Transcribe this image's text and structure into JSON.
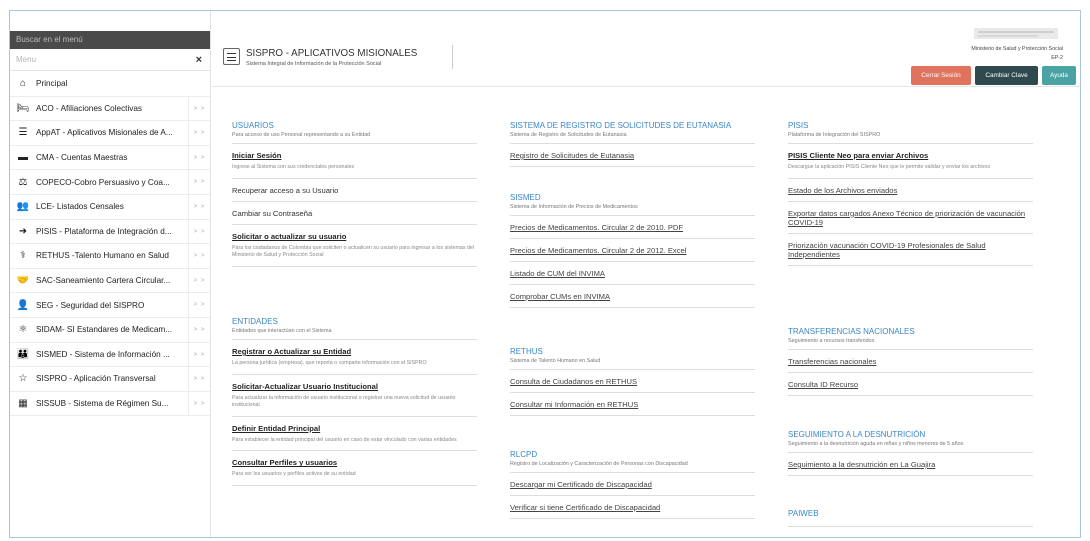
{
  "sidebar": {
    "search_placeholder": "Buscar en el menú",
    "filter_placeholder": "Menu",
    "principal": "Principal",
    "items": [
      {
        "label": "ACO - Afiliaciones Colectivas",
        "icon": "bed-icon",
        "glyph": "🛏"
      },
      {
        "label": "AppAT - Aplicativos Misionales de A...",
        "icon": "list-icon",
        "glyph": "☰"
      },
      {
        "label": "CMA - Cuentas Maestras",
        "icon": "card-icon",
        "glyph": "▬"
      },
      {
        "label": "COPECO-Cobro Persuasivo y Coa...",
        "icon": "gavel-icon",
        "glyph": "⚖"
      },
      {
        "label": "LCE- Listados Censales",
        "icon": "group-icon",
        "glyph": "👥"
      },
      {
        "label": "PISIS - Plataforma de Integración d...",
        "icon": "arrow-icon",
        "glyph": "➜"
      },
      {
        "label": "RETHUS -Talento Humano en Salud",
        "icon": "stethoscope-icon",
        "glyph": "⚕"
      },
      {
        "label": "SAC-Saneamiento Cartera Circular...",
        "icon": "handshake-icon",
        "glyph": "🤝"
      },
      {
        "label": "SEG - Seguridad del SISPRO",
        "icon": "user-icon",
        "glyph": "👤"
      },
      {
        "label": "SIDAM- SI Estandares de Medicam...",
        "icon": "molecule-icon",
        "glyph": "⚛"
      },
      {
        "label": "SISMED - Sistema de Información ...",
        "icon": "users-icon",
        "glyph": "👪"
      },
      {
        "label": "SISPRO - Aplicación Transversal",
        "icon": "star-icon",
        "glyph": "☆"
      },
      {
        "label": "SISSUB - Sistema de Régimen Su...",
        "icon": "building-icon",
        "glyph": "▦"
      }
    ]
  },
  "header": {
    "title": "SISPRO - APLICATIVOS MISIONALES",
    "subtitle": "Sistema Integral de Información de la Protección Social",
    "ministry": "Ministerio de Salud y Protección Social",
    "code": "EP-2",
    "buttons": {
      "logout": "Cerrar Sesión",
      "change_password": "Cambiar Clave",
      "help": "Ayuda"
    }
  },
  "columns": {
    "usuarios": {
      "title": "USUARIOS",
      "desc": "Para acceso de uso Personal representando a su Entidad",
      "items": [
        {
          "title": "Iniciar Sesión",
          "desc": "Ingrese al Sistema con sus credenciales personales"
        },
        {
          "title": "Recuperar acceso a su Usuario"
        },
        {
          "title": "Cambiar su Contraseña"
        },
        {
          "title": "Solicitar o actualizar su usuario",
          "desc": "Para los ciudadanos de Colombia que soliciten o actualicen su usuario para ingresar a los sistemas del Ministerio de Salud y Protección Social"
        }
      ]
    },
    "entidades": {
      "title": "ENTIDADES",
      "desc": "Entidades que interactúan con el Sistema",
      "items": [
        {
          "title": "Registrar o Actualizar su Entidad",
          "desc": "La persona jurídica (empresa), que reporta o comparte información con el SISPRO"
        },
        {
          "title": "Solicitar-Actualizar Usuario Institucional",
          "desc": "Para actualizar la información de usuario institucional o registrar una nueva solicitud de usuario institucional"
        },
        {
          "title": "Definir Entidad Principal",
          "desc": "Para establecer la entidad principal del usuario en caso de estar vinculado con varias entidades"
        },
        {
          "title": "Consultar Perfiles y usuarios",
          "desc": "Para ver los usuarios y perfiles activos de su entidad"
        }
      ]
    },
    "eutanasia": {
      "title": "SISTEMA DE REGISTRO DE SOLICITUDES DE EUTANASIA",
      "desc": "Sistema de Registro de Solicitudes de Eutanasia",
      "items": [
        {
          "title": "Registro de Solicitudes de Eutanasia"
        }
      ]
    },
    "sismed": {
      "title": "SISMED",
      "desc": "Sistema de Información de Precios de Medicamentos",
      "items": [
        {
          "title": "Precios de Medicamentos. Circular 2 de 2010. PDF"
        },
        {
          "title": "Precios de Medicamentos. Circular 2 de 2012. Excel"
        },
        {
          "title": "Listado de CUM del INVIMA"
        },
        {
          "title": "Comprobar CUMs en INVIMA"
        }
      ]
    },
    "rethus": {
      "title": "RETHUS",
      "desc": "Sistema de Talento Humano en Salud",
      "items": [
        {
          "title": "Consulta de Ciudadanos en RETHUS"
        },
        {
          "title": "Consultar mi Información en RETHUS"
        }
      ]
    },
    "rlcpd": {
      "title": "RLCPD",
      "desc": "Registro de Localización y Caracterización de Personas con Discapacidad",
      "items": [
        {
          "title": "Descargar mi Certificado de Discapacidad"
        },
        {
          "title": "Verificar si tiene Certificado de Discapacidad"
        }
      ]
    },
    "pisis": {
      "title": "PISIS",
      "desc": "Plataforma de Integración del SISPRO",
      "items": [
        {
          "title": "PISIS Cliente Neo para enviar Archivos",
          "desc": "Descargue la aplicación PISIS Cliente Neo que le permite validar y enviar los archivos"
        },
        {
          "title": "Estado de los Archivos enviados"
        },
        {
          "title": "Exportar datos cargados Anexo Técnico de priorización de vacunación COVID-19"
        },
        {
          "title": "Priorización vacunación COVID-19 Profesionales de Salud Independientes"
        }
      ]
    },
    "transferencias": {
      "title": "TRANSFERENCIAS NACIONALES",
      "desc": "Seguimiento a recursos transferidos",
      "items": [
        {
          "title": "Transferencias nacionales"
        },
        {
          "title": "Consulta ID Recurso"
        }
      ]
    },
    "desnutricion": {
      "title": "SEGUIMIENTO A LA DESNUTRICIÓN",
      "desc": "Seguimiento a la desnutrición aguda en niñas y niños menores de 5 años",
      "items": [
        {
          "title": "Seguimiento a la desnutrición en La Guajira"
        }
      ]
    },
    "paiweb": {
      "title": "PAIWEB"
    }
  }
}
